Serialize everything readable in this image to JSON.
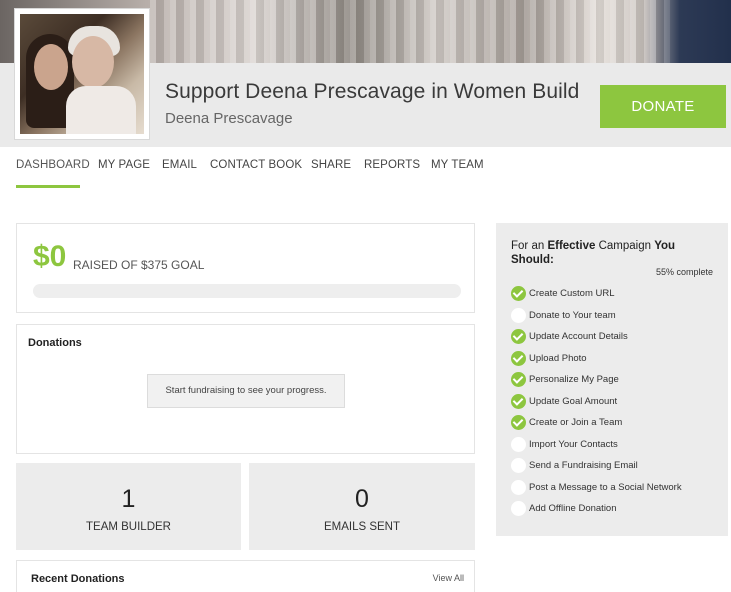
{
  "campaign": {
    "title": "Support Deena Prescavage in Women Build",
    "owner": "Deena Prescavage",
    "donate_label": "DONATE"
  },
  "nav": {
    "items": [
      {
        "label": "DASHBOARD"
      },
      {
        "label": "MY PAGE"
      },
      {
        "label": "EMAIL"
      },
      {
        "label": "CONTACT BOOK"
      },
      {
        "label": "SHARE"
      },
      {
        "label": "REPORTS"
      },
      {
        "label": "MY TEAM"
      }
    ]
  },
  "goal": {
    "raised": "$0",
    "text": "RAISED OF $375 GOAL",
    "progress_fraction": 0
  },
  "donations": {
    "heading": "Donations",
    "empty_message": "Start fundraising to see your progress."
  },
  "stats": {
    "team_builder": {
      "value": "1",
      "label": "TEAM BUILDER"
    },
    "emails_sent": {
      "value": "0",
      "label": "EMAILS SENT"
    }
  },
  "recent": {
    "heading": "Recent Donations",
    "view_all": "View All"
  },
  "checklist": {
    "title_part1": "For an ",
    "title_bold1": "Effective",
    "title_part2": " Campaign ",
    "title_bold2": "You",
    "title_bold3": "Should:",
    "complete": "55% complete",
    "items": [
      {
        "label": "Create Custom URL",
        "done": true
      },
      {
        "label": "Donate to Your team",
        "done": false
      },
      {
        "label": "Update Account Details",
        "done": true
      },
      {
        "label": "Upload Photo",
        "done": true
      },
      {
        "label": "Personalize My Page",
        "done": true
      },
      {
        "label": "Update Goal Amount",
        "done": true
      },
      {
        "label": "Create or Join a Team",
        "done": true
      },
      {
        "label": "Import Your Contacts",
        "done": false
      },
      {
        "label": "Send a Fundraising Email",
        "done": false
      },
      {
        "label": "Post a Message to a Social Network",
        "done": false
      },
      {
        "label": "Add Offline Donation",
        "done": false
      }
    ]
  },
  "colors": {
    "accent": "#8dc63f",
    "panel": "#ececec"
  }
}
